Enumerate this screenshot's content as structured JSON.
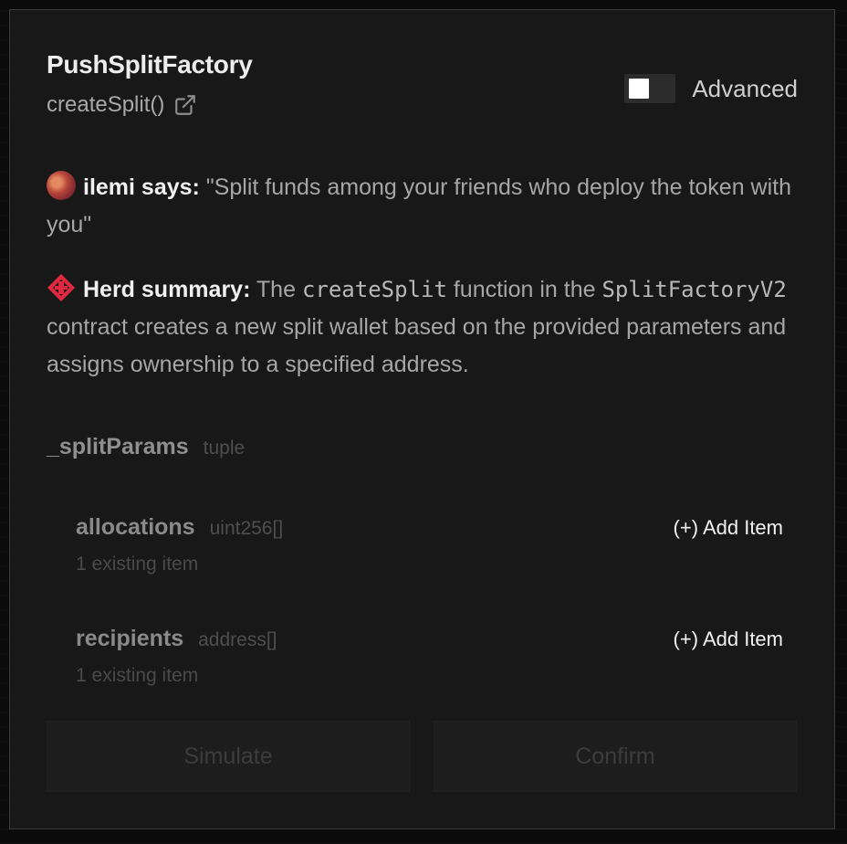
{
  "header": {
    "contract_name": "PushSplitFactory",
    "function_sig": "createSplit()",
    "advanced_label": "Advanced",
    "advanced_enabled": false
  },
  "says": {
    "author": "ilemi says:",
    "quote": "\"Split funds among your friends who deploy the token with you\""
  },
  "summary": {
    "label": "Herd summary:",
    "text_1": "The",
    "code_fn": "createSplit",
    "text_2": "function in the",
    "code_contract": "SplitFactoryV2",
    "text_3": "contract creates a new split wallet based on the provided parameters and assigns ownership to a specified address."
  },
  "params": {
    "name": "_splitParams",
    "type": "tuple",
    "fields": [
      {
        "name": "allocations",
        "type": "uint256[]",
        "add_label": "(+) Add Item",
        "existing": "1 existing item"
      },
      {
        "name": "recipients",
        "type": "address[]",
        "add_label": "(+) Add Item",
        "existing": "1 existing item"
      }
    ]
  },
  "actions": {
    "simulate": "Simulate",
    "confirm": "Confirm"
  },
  "colors": {
    "panel_bg": "#181818",
    "accent_red": "#e0283f"
  }
}
